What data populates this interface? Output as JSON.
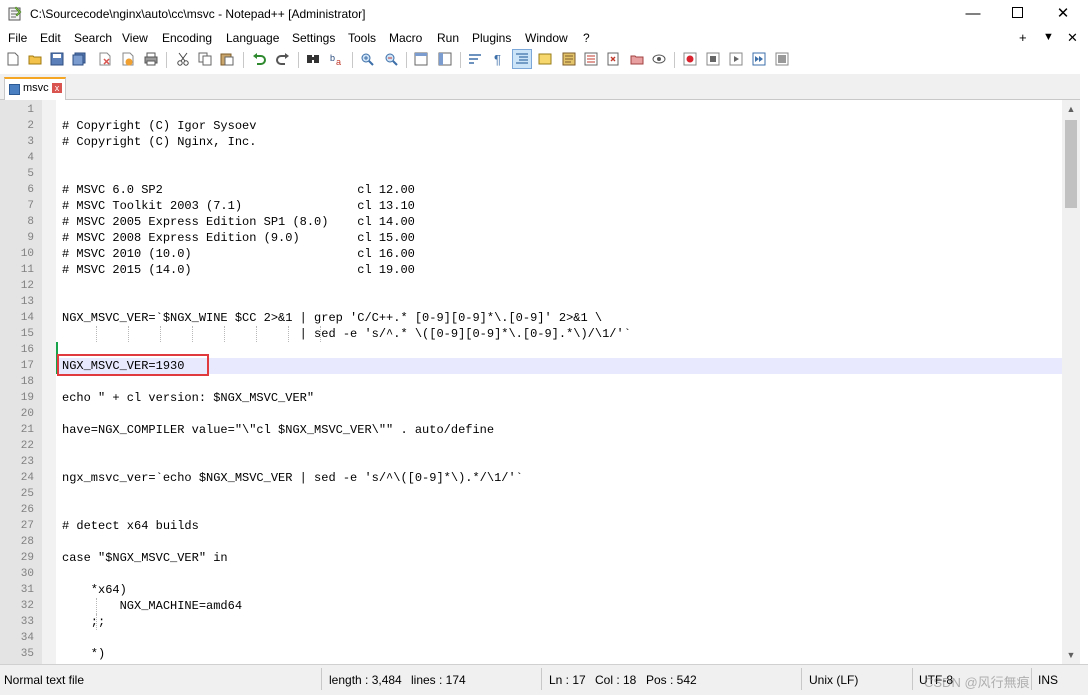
{
  "window": {
    "title": "C:\\Sourcecode\\nginx\\auto\\cc\\msvc - Notepad++ [Administrator]",
    "minimize_glyph": "—",
    "close_glyph": "✕"
  },
  "menu": {
    "items": [
      "File",
      "Edit",
      "Search",
      "View",
      "Encoding",
      "Language",
      "Settings",
      "Tools",
      "Macro",
      "Run",
      "Plugins",
      "Window",
      "?"
    ],
    "right": [
      "+",
      "▼",
      "✕"
    ]
  },
  "toolbar": {
    "icons": [
      "new-file-icon",
      "open-file-icon",
      "save-icon",
      "save-all-icon",
      "close-icon",
      "close-all-icon",
      "print-icon",
      "cut-icon",
      "copy-icon",
      "paste-icon",
      "undo-icon",
      "redo-icon",
      "find-icon",
      "replace-icon",
      "zoom-in-icon",
      "zoom-out-icon",
      "sync-vertical-icon",
      "sync-horizontal-icon",
      "word-wrap-icon",
      "show-all-chars-icon",
      "indent-guide-icon",
      "user-language-icon",
      "document-map-icon",
      "function-list-icon",
      "folder-workspace-icon",
      "monitoring-icon",
      "record-macro-icon",
      "stop-macro-icon",
      "play-macro-icon",
      "run-macro-multiple-icon",
      "save-macro-icon"
    ]
  },
  "tab": {
    "label": "msvc",
    "close_glyph": "x"
  },
  "editor": {
    "current_line": 17,
    "lines": [
      {
        "n": "1",
        "text": ""
      },
      {
        "n": "2",
        "text": "# Copyright (C) Igor Sysoev"
      },
      {
        "n": "3",
        "text": "# Copyright (C) Nginx, Inc."
      },
      {
        "n": "4",
        "text": ""
      },
      {
        "n": "5",
        "text": ""
      },
      {
        "n": "6",
        "text": "# MSVC 6.0 SP2                           cl 12.00"
      },
      {
        "n": "7",
        "text": "# MSVC Toolkit 2003 (7.1)                cl 13.10"
      },
      {
        "n": "8",
        "text": "# MSVC 2005 Express Edition SP1 (8.0)    cl 14.00"
      },
      {
        "n": "9",
        "text": "# MSVC 2008 Express Edition (9.0)        cl 15.00"
      },
      {
        "n": "10",
        "text": "# MSVC 2010 (10.0)                       cl 16.00"
      },
      {
        "n": "11",
        "text": "# MSVC 2015 (14.0)                       cl 19.00"
      },
      {
        "n": "12",
        "text": ""
      },
      {
        "n": "13",
        "text": ""
      },
      {
        "n": "14",
        "text": "NGX_MSVC_VER=`$NGX_WINE $CC 2>&1 | grep 'C/C++.* [0-9][0-9]*\\.[0-9]' 2>&1 \\"
      },
      {
        "n": "15",
        "text": "                                 | sed -e 's/^.* \\([0-9][0-9]*\\.[0-9].*\\)/\\1/'`"
      },
      {
        "n": "16",
        "text": ""
      },
      {
        "n": "17",
        "text": "NGX_MSVC_VER=1930"
      },
      {
        "n": "18",
        "text": ""
      },
      {
        "n": "19",
        "text": "echo \" + cl version: $NGX_MSVC_VER\""
      },
      {
        "n": "20",
        "text": ""
      },
      {
        "n": "21",
        "text": "have=NGX_COMPILER value=\"\\\"cl $NGX_MSVC_VER\\\"\" . auto/define"
      },
      {
        "n": "22",
        "text": ""
      },
      {
        "n": "23",
        "text": ""
      },
      {
        "n": "24",
        "text": "ngx_msvc_ver=`echo $NGX_MSVC_VER | sed -e 's/^\\([0-9]*\\).*/\\1/'`"
      },
      {
        "n": "25",
        "text": ""
      },
      {
        "n": "26",
        "text": ""
      },
      {
        "n": "27",
        "text": "# detect x64 builds"
      },
      {
        "n": "28",
        "text": ""
      },
      {
        "n": "29",
        "text": "case \"$NGX_MSVC_VER\" in"
      },
      {
        "n": "30",
        "text": ""
      },
      {
        "n": "31",
        "text": "    *x64)"
      },
      {
        "n": "32",
        "text": "        NGX_MACHINE=amd64"
      },
      {
        "n": "33",
        "text": "    ;;"
      },
      {
        "n": "34",
        "text": ""
      },
      {
        "n": "35",
        "text": "    *)"
      }
    ]
  },
  "status": {
    "file_type": "Normal text file",
    "length": "length : 3,484",
    "lines": "lines : 174",
    "ln": "Ln : 17",
    "col": "Col : 18",
    "pos": "Pos : 542",
    "eol": "Unix (LF)",
    "encoding": "UTF-8",
    "mode": "INS",
    "watermark": "CSDN @风行無痕"
  },
  "colors": {
    "current_line": "#e8e8ff",
    "highlight_box": "#e0393e",
    "change_marker": "#16a34a",
    "tab_accent": "#f5a623"
  }
}
